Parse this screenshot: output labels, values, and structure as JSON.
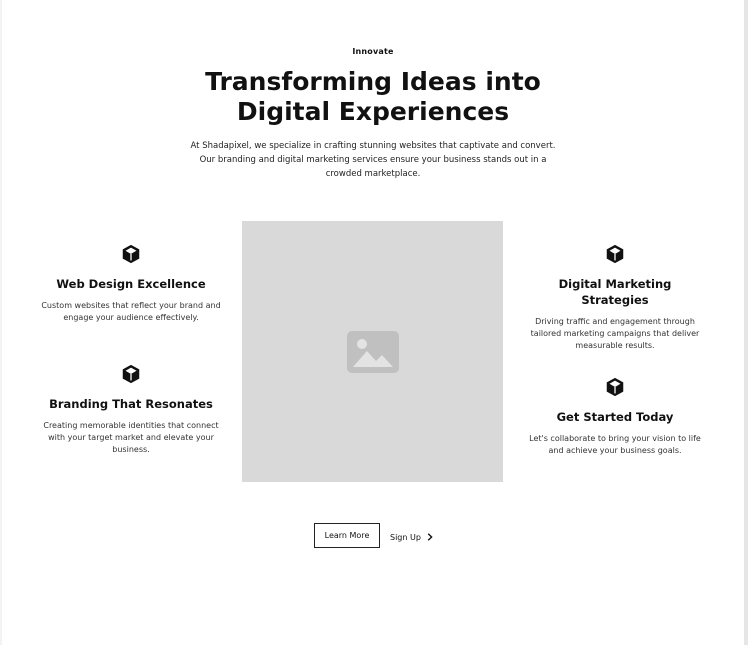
{
  "hero": {
    "tagline": "Innovate",
    "title": "Transforming Ideas into Digital Experiences",
    "intro": "At Shadapixel, we specialize in crafting stunning websites that captivate and convert. Our branding and digital marketing services ensure your business stands out in a crowded marketplace."
  },
  "features": {
    "left": [
      {
        "icon": "cube-icon",
        "title": "Web Design Excellence",
        "text": "Custom websites that reflect your brand and engage your audience effectively."
      },
      {
        "icon": "cube-icon",
        "title": "Branding That Resonates",
        "text": "Creating memorable identities that connect with your target market and elevate your business."
      }
    ],
    "right": [
      {
        "icon": "cube-icon",
        "title": "Digital Marketing Strategies",
        "text": "Driving traffic and engagement through tailored marketing campaigns that deliver measurable results."
      },
      {
        "icon": "cube-icon",
        "title": "Get Started Today",
        "text": "Let's collaborate to bring your vision to life and achieve your business goals."
      }
    ]
  },
  "image_placeholder": {
    "icon": "image-icon"
  },
  "actions": {
    "learn_more": "Learn More",
    "sign_up": "Sign Up"
  },
  "colors": {
    "background": "#ffffff",
    "text": "#111111",
    "placeholder": "#d9d9d9",
    "placeholder_icon": "#c0c0c0"
  }
}
